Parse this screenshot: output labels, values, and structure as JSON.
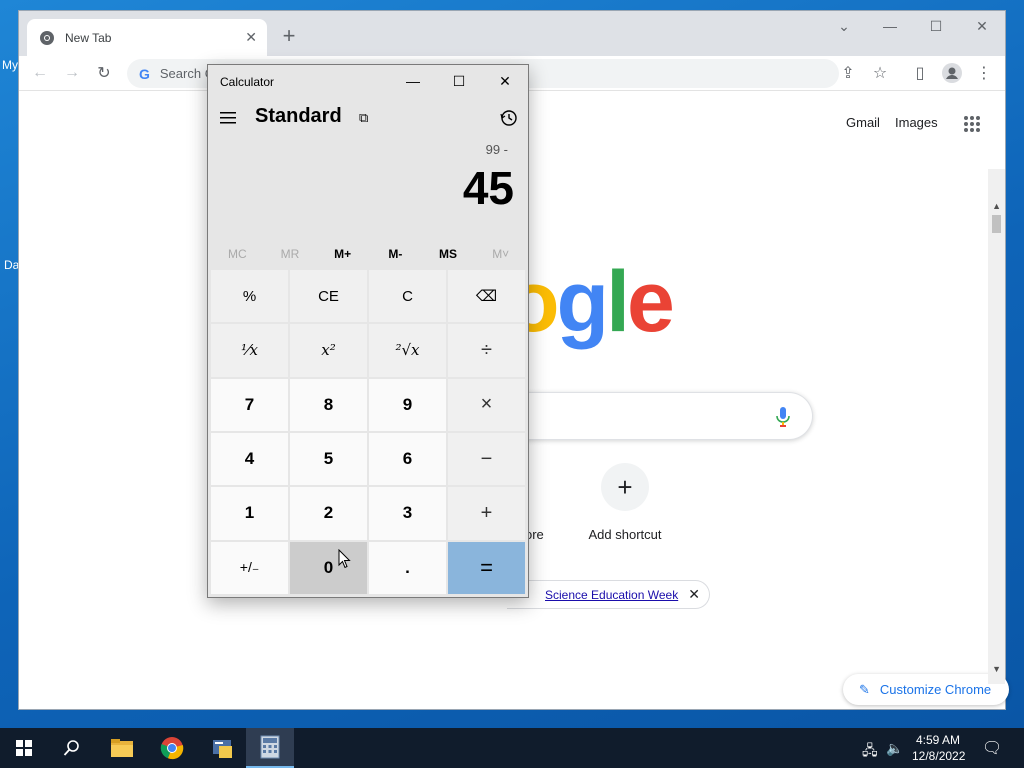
{
  "desktop": {
    "fragments": [
      "My",
      "Da"
    ]
  },
  "chrome": {
    "tab": {
      "title": "New Tab",
      "close": "✕"
    },
    "new_tab": "+",
    "window_controls": {
      "dropdown": "⌄",
      "minimize": "—",
      "maximize": "☐",
      "close": "✕"
    },
    "omnibox": {
      "visible_text": "Search G"
    },
    "ntp": {
      "links": [
        "Gmail",
        "Images"
      ],
      "logo_visible": "ogle",
      "shortcuts": [
        {
          "label": "Add shortcut",
          "icon": "plus-icon",
          "glyph": "+"
        }
      ],
      "fragment_label": "ore",
      "chip_text": "Science Education Week",
      "chip_close": "✕",
      "customize_label": "Customize Chrome"
    }
  },
  "calculator": {
    "title": "Calculator",
    "mode": "Standard",
    "expression": "99 -",
    "display": "45",
    "window_controls": {
      "minimize": "—",
      "maximize": "☐",
      "close": "✕"
    },
    "memory": [
      "MC",
      "MR",
      "M+",
      "M-",
      "MS",
      "M˅"
    ],
    "keys": [
      {
        "label": "%",
        "kind": "fn"
      },
      {
        "label": "CE",
        "kind": "fn"
      },
      {
        "label": "C",
        "kind": "fn"
      },
      {
        "label": "⌫",
        "kind": "fn"
      },
      {
        "label": "⅟x",
        "kind": "func"
      },
      {
        "label": "x²",
        "kind": "func"
      },
      {
        "label": "²√x",
        "kind": "func"
      },
      {
        "label": "÷",
        "kind": "op"
      },
      {
        "label": "7",
        "kind": "num"
      },
      {
        "label": "8",
        "kind": "num"
      },
      {
        "label": "9",
        "kind": "num"
      },
      {
        "label": "×",
        "kind": "op"
      },
      {
        "label": "4",
        "kind": "num"
      },
      {
        "label": "5",
        "kind": "num"
      },
      {
        "label": "6",
        "kind": "num"
      },
      {
        "label": "−",
        "kind": "op"
      },
      {
        "label": "1",
        "kind": "num"
      },
      {
        "label": "2",
        "kind": "num"
      },
      {
        "label": "3",
        "kind": "num"
      },
      {
        "label": "+",
        "kind": "op"
      },
      {
        "label": "+/₋",
        "kind": "num"
      },
      {
        "label": "0",
        "kind": "num"
      },
      {
        "label": ".",
        "kind": "num"
      },
      {
        "label": "=",
        "kind": "equals"
      }
    ]
  },
  "taskbar": {
    "clock_time": "4:59 AM",
    "clock_date": "12/8/2022",
    "items": [
      "start-icon",
      "search-icon",
      "file-explorer-icon",
      "chrome-icon",
      "python-icon",
      "calculator-icon"
    ],
    "active_item": "calculator-icon"
  },
  "colors": {
    "google_blue": "#4285f4",
    "google_red": "#ea4335",
    "google_yellow": "#fbbc05",
    "google_green": "#34a853",
    "calc_equals": "#8ab5dc",
    "calc_pressed": "#cccccc",
    "taskbar_bg": "#101c2c"
  }
}
